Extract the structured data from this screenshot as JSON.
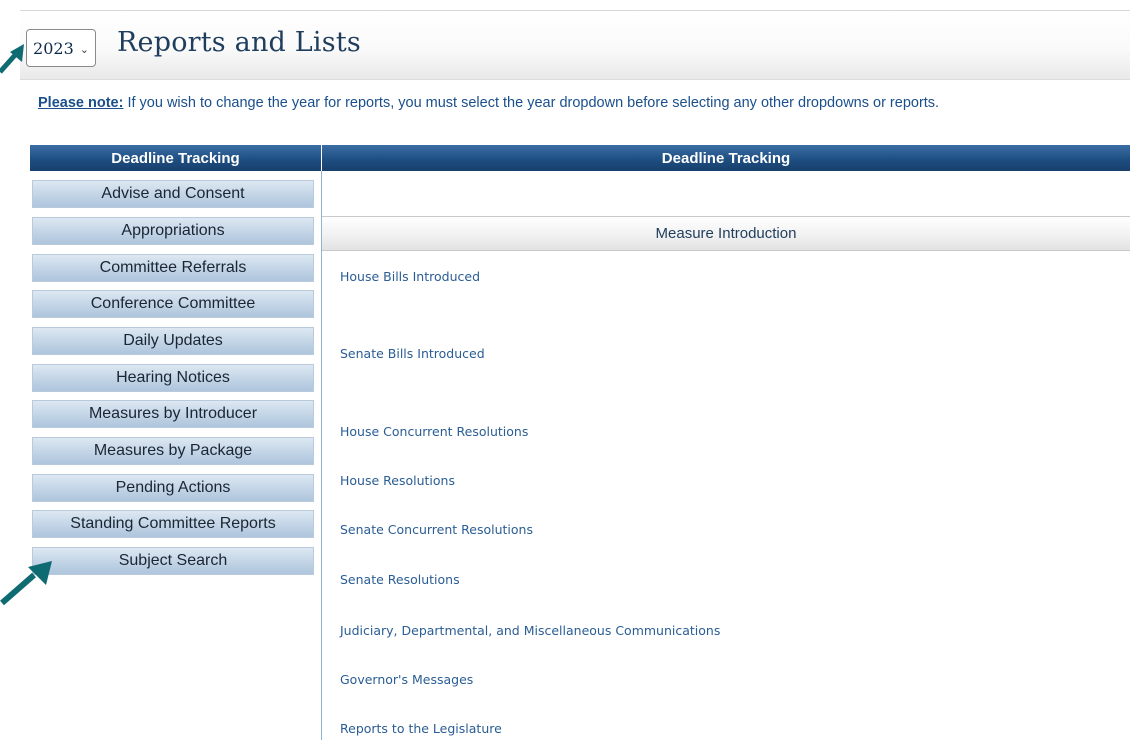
{
  "header": {
    "year_selected": "2023",
    "title": "Reports and Lists"
  },
  "note": {
    "label": "Please note:",
    "text": " If you wish to change the year for reports, you must select the year dropdown before selecting any other dropdowns or reports."
  },
  "left_menu": {
    "header": "Deadline Tracking",
    "items": [
      "Advise and Consent",
      "Appropriations",
      "Committee Referrals",
      "Conference Committee",
      "Daily Updates",
      "Hearing Notices",
      "Measures by Introducer",
      "Measures by Package",
      "Pending Actions",
      "Standing Committee Reports",
      "Subject Search"
    ]
  },
  "content": {
    "header": "Deadline Tracking",
    "section_title": "Measure Introduction",
    "links": [
      "House Bills Introduced",
      "Senate Bills Introduced",
      "House Concurrent Resolutions",
      "House Resolutions",
      "Senate Concurrent Resolutions",
      "Senate Resolutions",
      "Judiciary, Departmental, and Miscellaneous Communications",
      "Governor's Messages",
      "Reports to the Legislature"
    ]
  },
  "colors": {
    "header_blue": "#1f4f82",
    "link_blue": "#2a5d94",
    "menu_button": "#c2d4e6",
    "arrow_teal": "#0f6b72"
  }
}
